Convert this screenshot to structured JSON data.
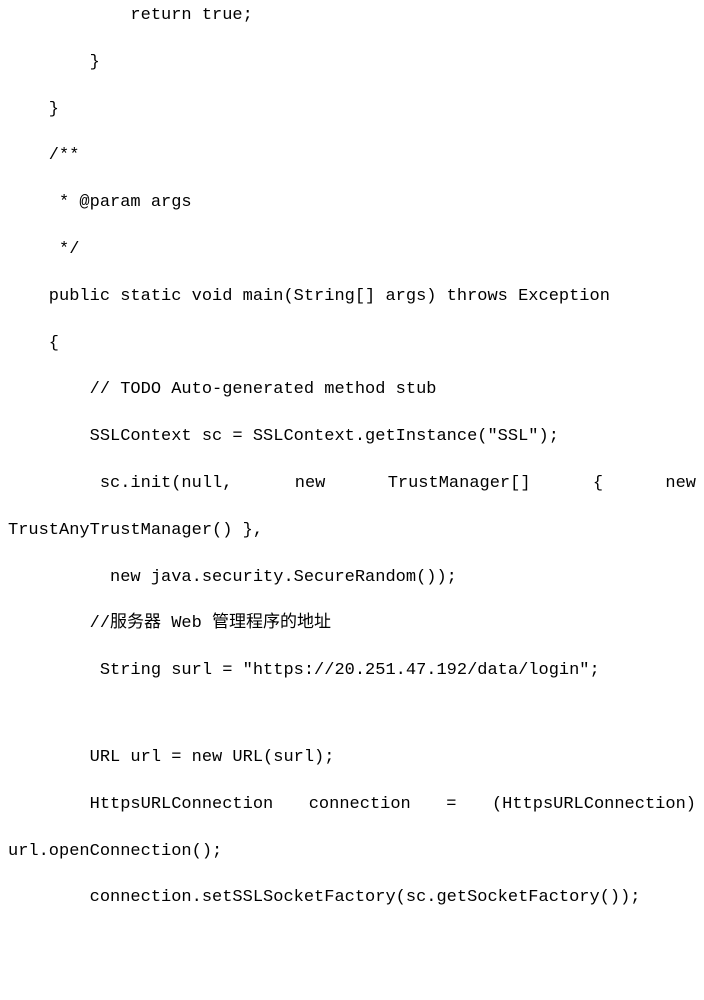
{
  "code": {
    "l1": "            return true;",
    "l2": "        }",
    "l3": "    }",
    "l4": "    /**",
    "l5": "     * @param args",
    "l6": "     */",
    "l7": "    public static void main(String[] args) throws Exception",
    "l8": "    {",
    "l9": "        // TODO Auto-generated method stub",
    "l10": "        SSLContext sc = SSLContext.getInstance(\"SSL\");",
    "l11a": "         sc.init(null,",
    "l11b": "new",
    "l11c": "TrustManager[]",
    "l11d": "{",
    "l11e": "new",
    "l12": "TrustAnyTrustManager() },",
    "l13": "          new java.security.SecureRandom());",
    "l14": "        //服务器 Web 管理程序的地址",
    "l15": "         String surl = \"https://20.251.47.192/data/login\";",
    "l16a": "        URL url = new URL(surl);",
    "l17a": "        HttpsURLConnection",
    "l17b": "connection",
    "l17c": "=",
    "l17d": "(HttpsURLConnection)",
    "l18": "url.openConnection();",
    "l19": "        connection.setSSLSocketFactory(sc.getSocketFactory());"
  }
}
